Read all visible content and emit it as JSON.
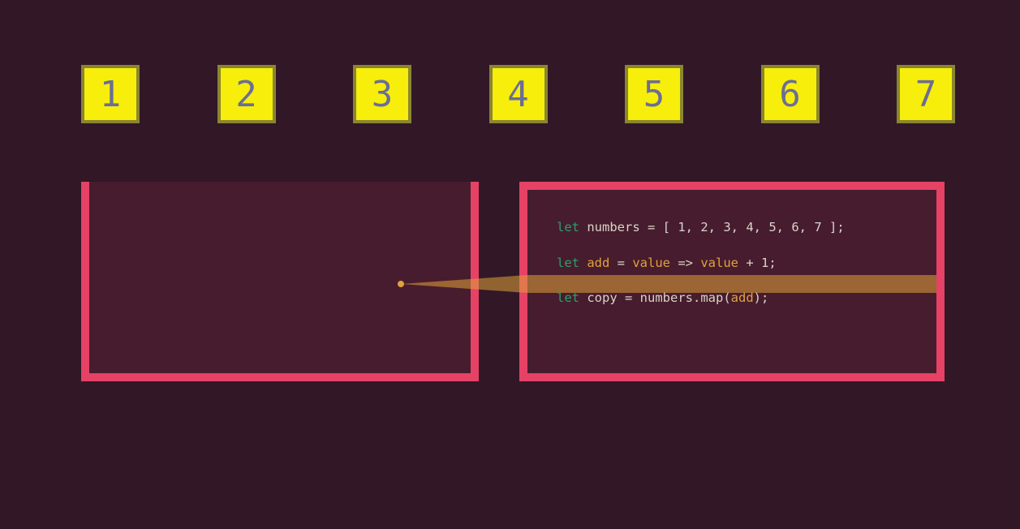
{
  "numbers_row": [
    "1",
    "2",
    "3",
    "4",
    "5",
    "6",
    "7"
  ],
  "code": {
    "line1": {
      "let": "let",
      "name": "numbers",
      "eq": " = [ ",
      "vals": "1, 2, 3, 4, 5, 6, 7",
      "close": " ];"
    },
    "line2": {
      "let": "let",
      "name": "add",
      "eq": " = ",
      "param": "value",
      "arrow": " => ",
      "param2": "value",
      "rest": " + 1;"
    },
    "line3": {
      "let": "let",
      "name": "copy",
      "eq": " = numbers.map(",
      "arg": "add",
      "close": ");"
    }
  },
  "colors": {
    "bg": "#321727",
    "box_fill": "#f7ee0b",
    "box_border": "#8a8630",
    "box_text": "#6b6e95",
    "panel_border": "#e54266",
    "keyword": "#2aa06a",
    "definition": "#e0a23a",
    "text": "#d8d4c9",
    "highlight": "rgba(224,162,58,0.55)"
  }
}
